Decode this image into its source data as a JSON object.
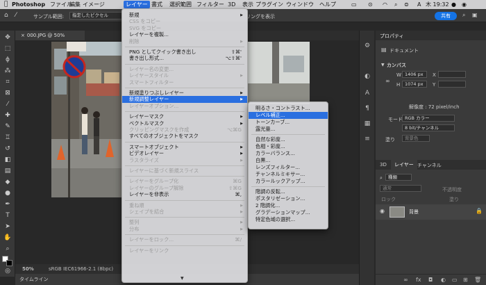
{
  "menubar": {
    "apple_icon": "apple-logo",
    "app": "Photoshop",
    "items": [
      "ファイル",
      "編集",
      "イメージ",
      "レイヤー",
      "書式",
      "選択範囲",
      "フィルター",
      "3D",
      "表示",
      "プラグイン",
      "ウィンドウ",
      "ヘルプ"
    ],
    "right_title": "hop 2022",
    "clock": "木 19:32"
  },
  "options": {
    "sample_label": "サンプル範囲:",
    "sample_value": "指定したピクセル",
    "show_ring": "リングを表示",
    "share": "共有"
  },
  "doc": {
    "tab": "000.JPG @ 50% (RGB/8) *"
  },
  "status": {
    "zoom": "50%",
    "profile": "sRGB IEC61966-2.1 (8bpc)"
  },
  "timeline": "タイムライン",
  "props": {
    "tab": "プロパティ",
    "doc_label": "ドキュメント",
    "canvas_label": "カンバス",
    "w_label": "W",
    "w_value": "1406 px",
    "x_label": "X",
    "h_label": "H",
    "h_value": "1074 px",
    "y_label": "Y",
    "resolution": "解像度 : 72 pixel/inch",
    "mode_label": "モード",
    "mode_value": "RGB カラー",
    "bits_value": "8 bit/チャンネル",
    "fill_label": "塗り",
    "fill_value": "背景色"
  },
  "layers": {
    "tabs": [
      "3D",
      "レイヤー",
      "チャンネル"
    ],
    "kind": "種類",
    "blend": "通常",
    "opacity": "不透明度",
    "lock": "ロック",
    "fill": "塗り",
    "layer_name": "背景"
  },
  "layer_menu": [
    {
      "t": "新規",
      "a": 1
    },
    {
      "t": "CSS をコピー",
      "d": 1
    },
    {
      "t": "SVG をコピー",
      "d": 1
    },
    {
      "t": "レイヤーを複製..."
    },
    {
      "t": "削除",
      "d": 1,
      "a": 1
    },
    {
      "sep": 1
    },
    {
      "t": "PNG としてクイック書き出し",
      "s": "⇧⌘'"
    },
    {
      "t": "書き出し形式...",
      "s": "⌥⇧⌘'"
    },
    {
      "sep": 1
    },
    {
      "t": "レイヤー名の変更...",
      "d": 1
    },
    {
      "t": "レイヤースタイル",
      "d": 1,
      "a": 1
    },
    {
      "t": "スマートフィルター",
      "d": 1
    },
    {
      "sep": 1
    },
    {
      "t": "新規塗りつぶしレイヤー",
      "a": 1
    },
    {
      "t": "新規調整レイヤー",
      "a": 1,
      "h": 1
    },
    {
      "t": "レイヤーオプション...",
      "d": 1
    },
    {
      "sep": 1
    },
    {
      "t": "レイヤーマスク",
      "a": 1
    },
    {
      "t": "ベクトルマスク",
      "a": 1
    },
    {
      "t": "クリッピングマスクを作成",
      "d": 1,
      "s": "⌥⌘G"
    },
    {
      "t": "すべてのオブジェクトをマスク"
    },
    {
      "sep": 1
    },
    {
      "t": "スマートオブジェクト",
      "a": 1
    },
    {
      "t": "ビデオレイヤー",
      "a": 1
    },
    {
      "t": "ラスタライズ",
      "d": 1,
      "a": 1
    },
    {
      "sep": 1
    },
    {
      "t": "レイヤーに基づく新規スライス",
      "d": 1
    },
    {
      "sep": 1
    },
    {
      "t": "レイヤーをグループ化",
      "d": 1,
      "s": "⌘G"
    },
    {
      "t": "レイヤーのグループ解除",
      "d": 1,
      "s": "⇧⌘G"
    },
    {
      "t": "レイヤーを非表示",
      "s": "⌘,"
    },
    {
      "sep": 1
    },
    {
      "t": "重ね順",
      "d": 1,
      "a": 1
    },
    {
      "t": "シェイプを結合",
      "d": 1,
      "a": 1
    },
    {
      "sep": 1
    },
    {
      "t": "整列",
      "d": 1,
      "a": 1
    },
    {
      "t": "分布",
      "d": 1,
      "a": 1
    },
    {
      "sep": 1
    },
    {
      "t": "レイヤーをロック...",
      "d": 1,
      "s": "⌘/"
    },
    {
      "sep": 1
    },
    {
      "t": "レイヤーをリンク",
      "d": 1
    }
  ],
  "adjust_menu": [
    {
      "t": "明るさ・コントラスト..."
    },
    {
      "t": "レベル補正...",
      "h": 1
    },
    {
      "t": "トーンカーブ..."
    },
    {
      "t": "露光量..."
    },
    {
      "sep": 1
    },
    {
      "t": "自然な彩度..."
    },
    {
      "t": "色相・彩度..."
    },
    {
      "t": "カラーバランス..."
    },
    {
      "t": "白黒..."
    },
    {
      "t": "レンズフィルター..."
    },
    {
      "t": "チャンネルミキサー..."
    },
    {
      "t": "カラールックアップ..."
    },
    {
      "sep": 1
    },
    {
      "t": "階調の反転..."
    },
    {
      "t": "ポスタリゼーション..."
    },
    {
      "t": "2 階調化..."
    },
    {
      "t": "グラデーションマップ..."
    },
    {
      "t": "特定色域の選択..."
    }
  ]
}
